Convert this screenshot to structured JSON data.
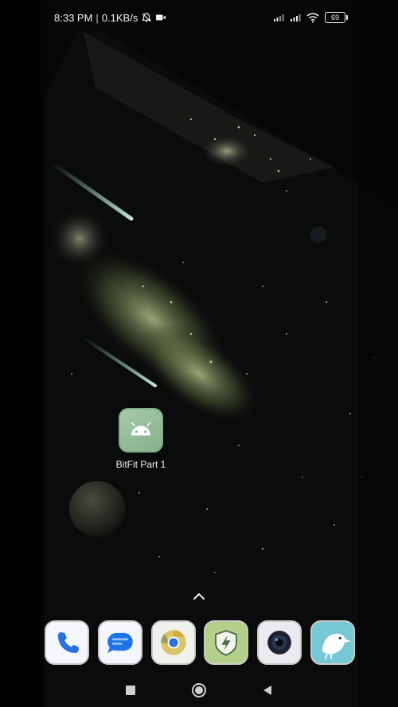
{
  "status_bar": {
    "time": "8:33 PM",
    "separator": "|",
    "network_speed": "0.1KB/s",
    "battery_level": "69",
    "icons": [
      "bell-off-icon",
      "video-record-icon",
      "signal-icon",
      "signal-icon",
      "wifi-icon",
      "battery-icon"
    ]
  },
  "home": {
    "apps": [
      {
        "label": "BitFit Part 1",
        "icon": "android-robot-icon",
        "color": "#9dc3a0"
      }
    ]
  },
  "dock": {
    "apps": [
      {
        "icon": "phone-icon"
      },
      {
        "icon": "messages-icon"
      },
      {
        "icon": "chrome-icon"
      },
      {
        "icon": "security-shield-icon"
      },
      {
        "icon": "camera-icon"
      },
      {
        "icon": "kiwi-bird-icon"
      }
    ]
  },
  "navigation": {
    "buttons": [
      "recents-icon",
      "home-icon",
      "back-icon"
    ]
  },
  "colors": {
    "background": "#050607",
    "app_tile": "#9dc3a0",
    "nebula": "#b8c98a"
  }
}
